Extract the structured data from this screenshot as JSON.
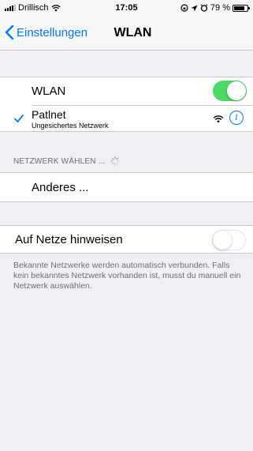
{
  "status_bar": {
    "carrier": "Drillisch",
    "time": "17:05",
    "battery_percent": "79 %",
    "battery_level": 0.79
  },
  "nav": {
    "back_label": "Einstellungen",
    "title": "WLAN"
  },
  "wlan_section": {
    "wlan_label": "WLAN",
    "wlan_enabled": true,
    "connected_network": {
      "name": "Patlnet",
      "subtitle": "Ungesichertes Netzwerk"
    }
  },
  "choose_network": {
    "header": "NETZWERK WÄHLEN ...",
    "other_label": "Anderes ..."
  },
  "ask_to_join": {
    "label": "Auf Netze hinweisen",
    "enabled": false,
    "footer": "Bekannte Netzwerke werden automatisch verbunden. Falls kein bekanntes Netzwerk vorhanden ist, musst du manuell ein Netzwerk auswählen."
  },
  "icons": {
    "signal": "signal-bars-icon",
    "wifi": "wifi-icon",
    "location": "location-arrow-icon",
    "alarm": "alarm-icon",
    "battery": "battery-icon",
    "back": "chevron-left-icon",
    "check": "checkmark-icon",
    "info": "info-icon",
    "spinner": "activity-spinner-icon"
  },
  "colors": {
    "accent": "#007aff",
    "toggle_on": "#4cd964",
    "background": "#efeff4"
  }
}
